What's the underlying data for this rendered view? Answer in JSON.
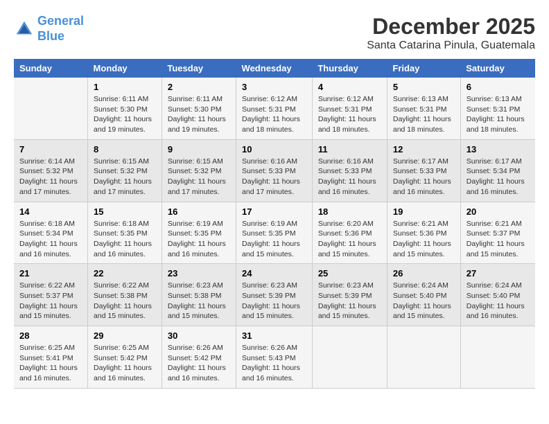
{
  "header": {
    "logo_line1": "General",
    "logo_line2": "Blue",
    "month": "December 2025",
    "location": "Santa Catarina Pinula, Guatemala"
  },
  "days_of_week": [
    "Sunday",
    "Monday",
    "Tuesday",
    "Wednesday",
    "Thursday",
    "Friday",
    "Saturday"
  ],
  "weeks": [
    [
      {
        "day": "",
        "info": ""
      },
      {
        "day": "1",
        "info": "Sunrise: 6:11 AM\nSunset: 5:30 PM\nDaylight: 11 hours\nand 19 minutes."
      },
      {
        "day": "2",
        "info": "Sunrise: 6:11 AM\nSunset: 5:30 PM\nDaylight: 11 hours\nand 19 minutes."
      },
      {
        "day": "3",
        "info": "Sunrise: 6:12 AM\nSunset: 5:31 PM\nDaylight: 11 hours\nand 18 minutes."
      },
      {
        "day": "4",
        "info": "Sunrise: 6:12 AM\nSunset: 5:31 PM\nDaylight: 11 hours\nand 18 minutes."
      },
      {
        "day": "5",
        "info": "Sunrise: 6:13 AM\nSunset: 5:31 PM\nDaylight: 11 hours\nand 18 minutes."
      },
      {
        "day": "6",
        "info": "Sunrise: 6:13 AM\nSunset: 5:31 PM\nDaylight: 11 hours\nand 18 minutes."
      }
    ],
    [
      {
        "day": "7",
        "info": "Sunrise: 6:14 AM\nSunset: 5:32 PM\nDaylight: 11 hours\nand 17 minutes."
      },
      {
        "day": "8",
        "info": "Sunrise: 6:15 AM\nSunset: 5:32 PM\nDaylight: 11 hours\nand 17 minutes."
      },
      {
        "day": "9",
        "info": "Sunrise: 6:15 AM\nSunset: 5:32 PM\nDaylight: 11 hours\nand 17 minutes."
      },
      {
        "day": "10",
        "info": "Sunrise: 6:16 AM\nSunset: 5:33 PM\nDaylight: 11 hours\nand 17 minutes."
      },
      {
        "day": "11",
        "info": "Sunrise: 6:16 AM\nSunset: 5:33 PM\nDaylight: 11 hours\nand 16 minutes."
      },
      {
        "day": "12",
        "info": "Sunrise: 6:17 AM\nSunset: 5:33 PM\nDaylight: 11 hours\nand 16 minutes."
      },
      {
        "day": "13",
        "info": "Sunrise: 6:17 AM\nSunset: 5:34 PM\nDaylight: 11 hours\nand 16 minutes."
      }
    ],
    [
      {
        "day": "14",
        "info": "Sunrise: 6:18 AM\nSunset: 5:34 PM\nDaylight: 11 hours\nand 16 minutes."
      },
      {
        "day": "15",
        "info": "Sunrise: 6:18 AM\nSunset: 5:35 PM\nDaylight: 11 hours\nand 16 minutes."
      },
      {
        "day": "16",
        "info": "Sunrise: 6:19 AM\nSunset: 5:35 PM\nDaylight: 11 hours\nand 16 minutes."
      },
      {
        "day": "17",
        "info": "Sunrise: 6:19 AM\nSunset: 5:35 PM\nDaylight: 11 hours\nand 15 minutes."
      },
      {
        "day": "18",
        "info": "Sunrise: 6:20 AM\nSunset: 5:36 PM\nDaylight: 11 hours\nand 15 minutes."
      },
      {
        "day": "19",
        "info": "Sunrise: 6:21 AM\nSunset: 5:36 PM\nDaylight: 11 hours\nand 15 minutes."
      },
      {
        "day": "20",
        "info": "Sunrise: 6:21 AM\nSunset: 5:37 PM\nDaylight: 11 hours\nand 15 minutes."
      }
    ],
    [
      {
        "day": "21",
        "info": "Sunrise: 6:22 AM\nSunset: 5:37 PM\nDaylight: 11 hours\nand 15 minutes."
      },
      {
        "day": "22",
        "info": "Sunrise: 6:22 AM\nSunset: 5:38 PM\nDaylight: 11 hours\nand 15 minutes."
      },
      {
        "day": "23",
        "info": "Sunrise: 6:23 AM\nSunset: 5:38 PM\nDaylight: 11 hours\nand 15 minutes."
      },
      {
        "day": "24",
        "info": "Sunrise: 6:23 AM\nSunset: 5:39 PM\nDaylight: 11 hours\nand 15 minutes."
      },
      {
        "day": "25",
        "info": "Sunrise: 6:23 AM\nSunset: 5:39 PM\nDaylight: 11 hours\nand 15 minutes."
      },
      {
        "day": "26",
        "info": "Sunrise: 6:24 AM\nSunset: 5:40 PM\nDaylight: 11 hours\nand 15 minutes."
      },
      {
        "day": "27",
        "info": "Sunrise: 6:24 AM\nSunset: 5:40 PM\nDaylight: 11 hours\nand 16 minutes."
      }
    ],
    [
      {
        "day": "28",
        "info": "Sunrise: 6:25 AM\nSunset: 5:41 PM\nDaylight: 11 hours\nand 16 minutes."
      },
      {
        "day": "29",
        "info": "Sunrise: 6:25 AM\nSunset: 5:42 PM\nDaylight: 11 hours\nand 16 minutes."
      },
      {
        "day": "30",
        "info": "Sunrise: 6:26 AM\nSunset: 5:42 PM\nDaylight: 11 hours\nand 16 minutes."
      },
      {
        "day": "31",
        "info": "Sunrise: 6:26 AM\nSunset: 5:43 PM\nDaylight: 11 hours\nand 16 minutes."
      },
      {
        "day": "",
        "info": ""
      },
      {
        "day": "",
        "info": ""
      },
      {
        "day": "",
        "info": ""
      }
    ]
  ]
}
